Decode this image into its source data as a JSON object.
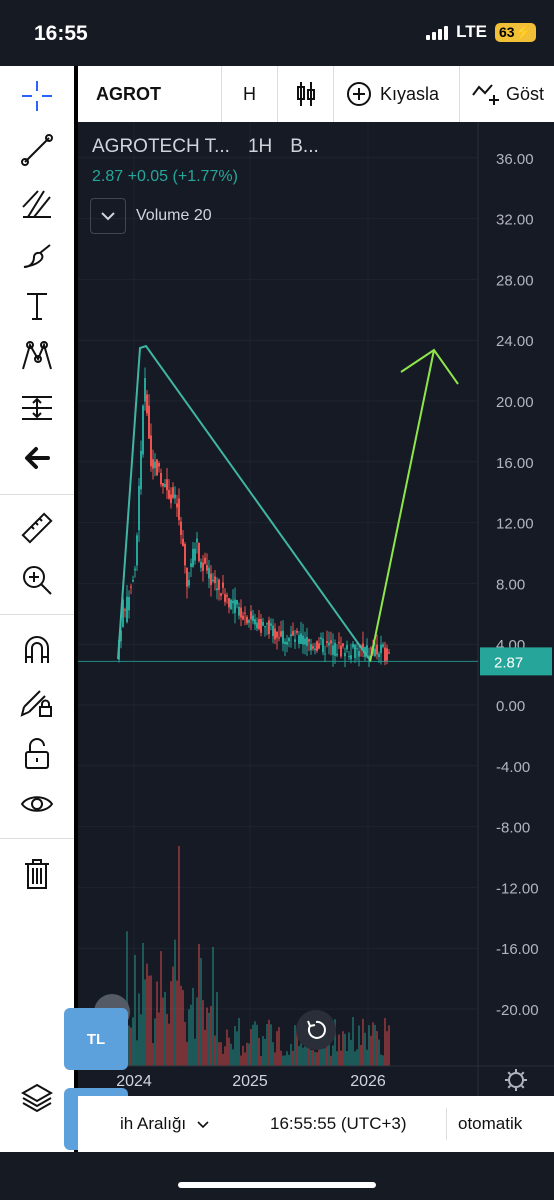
{
  "status": {
    "time": "16:55",
    "network": "LTE",
    "battery": "63"
  },
  "toolbar": {
    "symbol": "AGROT",
    "interval": "H",
    "compare_label": "Kıyasla",
    "indicators_label": "Göst"
  },
  "legend": {
    "name": "AGROTECH T...",
    "interval": "1H",
    "exchange": "B...",
    "last_price": "2.87",
    "change": "+0.05 (+1.77%)",
    "volume_label": "Volume 20"
  },
  "price_axis": {
    "ticks": [
      "36.00",
      "32.00",
      "28.00",
      "24.00",
      "20.00",
      "16.00",
      "12.00",
      "8.00",
      "4.00",
      "0.00",
      "-4.00",
      "-8.00",
      "-12.00",
      "-16.00",
      "-20.00"
    ],
    "current_price": "2.87"
  },
  "time_axis": {
    "ticks": [
      "2024",
      "2025",
      "2026"
    ]
  },
  "bottom": {
    "date_range": "ih Aralığı",
    "clock": "16:55:55 (UTC+3)",
    "mode": "otomatik"
  },
  "buttons": {
    "currency": "TL"
  },
  "colors": {
    "up": "#26a69a",
    "down": "#ef5350",
    "trendline": "#3fb6a4",
    "projection": "#8ee64a",
    "panel": "#161a25",
    "accent": "#5ca0dc"
  }
}
